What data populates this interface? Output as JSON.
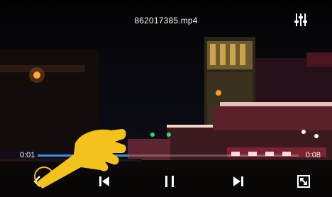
{
  "player": {
    "title": "862017385.mp4",
    "current_time": "0:01",
    "total_time": "0:08",
    "progress": 0.35
  },
  "icons": {
    "equalizer": "equalizer-icon",
    "back": "chevron-left-icon",
    "previous": "skip-previous-icon",
    "pause": "pause-icon",
    "next": "skip-next-icon",
    "fullscreen": "fullscreen-icon"
  },
  "colors": {
    "seek_fill": "#3b8fe0",
    "hand": "#f4c21c"
  }
}
